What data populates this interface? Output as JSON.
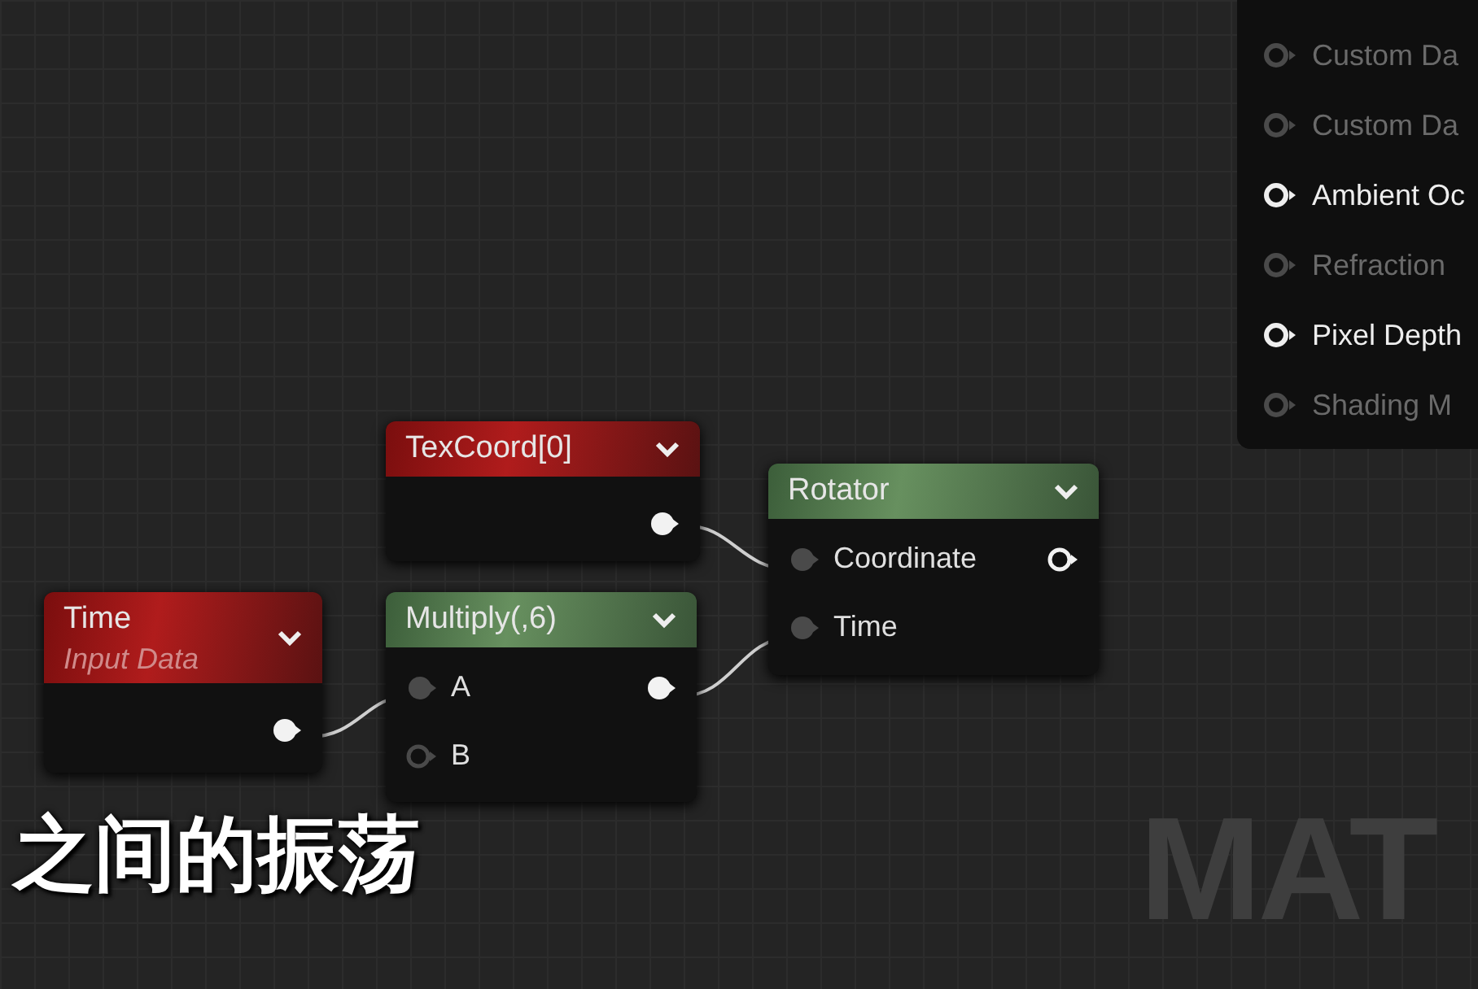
{
  "material_output": {
    "pins": [
      {
        "label": "Custom Da",
        "enabled": false
      },
      {
        "label": "Custom Da",
        "enabled": false
      },
      {
        "label": "Ambient Oc",
        "enabled": true
      },
      {
        "label": "Refraction",
        "enabled": false
      },
      {
        "label": "Pixel Depth",
        "enabled": true
      },
      {
        "label": "Shading M",
        "enabled": false
      }
    ]
  },
  "nodes": [
    {
      "title": "TexCoord[0]",
      "kind": "input",
      "outputs": [
        {
          "connected": true
        }
      ]
    },
    {
      "title": "Time",
      "subtitle": "Input Data",
      "kind": "input",
      "outputs": [
        {
          "connected": true
        }
      ]
    },
    {
      "title": "Multiply(,6)",
      "kind": "math",
      "inputs": [
        {
          "label": "A",
          "connected": true
        },
        {
          "label": "B",
          "connected": false
        }
      ],
      "outputs": [
        {
          "connected": true
        }
      ]
    },
    {
      "title": "Rotator",
      "kind": "math",
      "inputs": [
        {
          "label": "Coordinate",
          "connected": true
        },
        {
          "label": "Time",
          "connected": true
        }
      ],
      "outputs": [
        {
          "connected": false
        }
      ]
    }
  ],
  "graph_watermark": "MAT",
  "subtitle": "之间的振荡"
}
